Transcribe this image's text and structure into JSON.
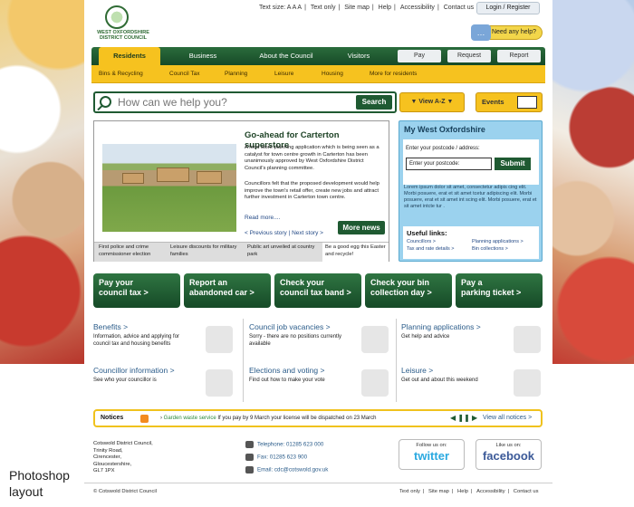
{
  "caption": "Photoshop layout",
  "header": {
    "logo_line1": "WEST OXFORDSHIRE",
    "logo_line2": "DISTRICT COUNCIL",
    "top_links": [
      "Text size: A A A",
      "Text only",
      "Site map",
      "Help",
      "Accessibility",
      "Contact us"
    ],
    "login_label": "Login / Register",
    "help_label": "Need any help?"
  },
  "nav": {
    "tabs": [
      "Residents",
      "Business",
      "About the Council",
      "Visitors"
    ],
    "pills": [
      "Pay",
      "Request",
      "Report"
    ],
    "sub": [
      "Bins & Recycling",
      "Council Tax",
      "Planning",
      "Leisure",
      "Housing",
      "More for residents"
    ]
  },
  "search": {
    "placeholder": "How can we help you?",
    "button": "Search"
  },
  "view_az": "View A-Z",
  "events": "Events",
  "news": {
    "headline": "Go-ahead for Carterton superstore",
    "p1": "A food store planning application which is being seen as a catalyst for town centre growth in Carterton has been unanimously approved by West Oxfordshire District Council's planning committee.",
    "p2": "Councillors felt that the proposed development would help improve the town's retail offer, create new jobs and attract further investment in Carterton town centre.",
    "read_more": "Read more....",
    "prev": "< Previous story",
    "next": "Next story >",
    "more_news": "More news",
    "strip": [
      "First police and crime commissioner election",
      "Leisure discounts for military families",
      "Public art unveiled at country park",
      "Be a good egg this Easter and recycle!"
    ]
  },
  "my_wo": {
    "title": "My West Oxfordshire",
    "postcode_label": "Enter your postcode / address:",
    "postcode_value": "Enter your postcode:",
    "submit": "Submit",
    "lorem": "Lorem ipsum dolor sit amet, consectetur adipis cing elit. Morbi posuere, erat et sit amet tcetur adipiscing elit. Morbi posuere, erat et sit amet int scing elit. Morbi posuere, erat et sit amet intcte tur .",
    "useful_title": "Useful links:",
    "useful_links": [
      "Councillors >",
      "Tax and rate details >",
      "Planning applications >",
      "Bin collections >"
    ]
  },
  "cta": [
    {
      "l1": "Pay your",
      "l2": "council tax >"
    },
    {
      "l1": "Report an",
      "l2": "abandoned car >"
    },
    {
      "l1": "Check your",
      "l2": "council tax band >"
    },
    {
      "l1": "Check your bin",
      "l2": "collection day >"
    },
    {
      "l1": "Pay a",
      "l2": "parking ticket >"
    }
  ],
  "sections": [
    {
      "h": "Benefits >",
      "d": "Information, advice and applying for council tax and housing benefits"
    },
    {
      "h": "Council job vacancies >",
      "d": "Sorry - there are no positions currently available"
    },
    {
      "h": "Planning applications >",
      "d": "Get help and advice"
    },
    {
      "h": "Councillor information >",
      "d": "See who your councillor is"
    },
    {
      "h": "Elections and voting >",
      "d": "Find out how to make your vote"
    },
    {
      "h": "Leisure >",
      "d": "Get out and about this weekend"
    }
  ],
  "notices": {
    "title": "Notices",
    "link": "Garden waste service",
    "msg": " If you pay by 9 March your license will be dispatched on 23 March",
    "view_all": "View all notices >"
  },
  "address": [
    "Cotswold District Council,",
    "Trinity Road,",
    "Cirencester,",
    "Gloucestershire,",
    "GL7 1PX"
  ],
  "contact": {
    "telephone": "Telephone: 01285 623 000",
    "fax": "Fax: 01285 623 900",
    "email": "Email: cdc@cotswold.gov.uk"
  },
  "social": {
    "twitter_follow": "Follow us on:",
    "twitter": "twitter",
    "facebook_like": "Like us on:",
    "facebook": "facebook"
  },
  "footer": {
    "copyright": "© Cotswold District Council",
    "links": [
      "Text only",
      "Site map",
      "Help",
      "Accessibility",
      "Contact us"
    ]
  },
  "colors": {
    "green": "#1f5a32",
    "yellow": "#f6c21f",
    "light_blue": "#9bd2ee",
    "link_blue": "#2b5c8a"
  }
}
